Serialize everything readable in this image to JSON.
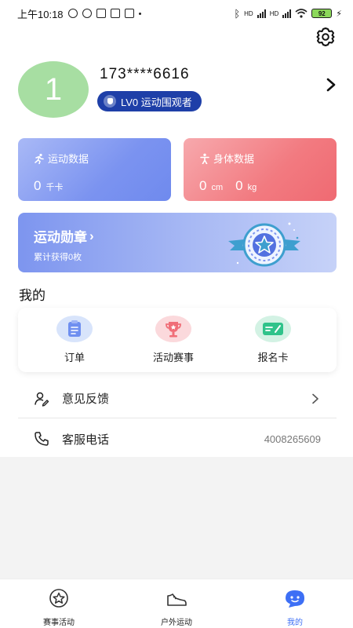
{
  "status_bar": {
    "time": "上午10:18",
    "battery": "92",
    "net_label_1": "HD",
    "net_label_2": "HD"
  },
  "profile": {
    "avatar_text": "1",
    "phone": "173****6616",
    "level_badge": "LV0 运动围观者"
  },
  "stats": {
    "sport": {
      "title": "运动数据",
      "value": "0",
      "unit": "千卡"
    },
    "body": {
      "title": "身体数据",
      "height_value": "0",
      "height_unit": "cm",
      "weight_value": "0",
      "weight_unit": "kg"
    }
  },
  "medal": {
    "title": "运动勋章",
    "arrow": "›",
    "subtitle": "累计获得0枚"
  },
  "section_title": "我的",
  "shortcuts": [
    {
      "label": "订单",
      "icon": "clipboard-icon"
    },
    {
      "label": "活动赛事",
      "icon": "trophy-icon"
    },
    {
      "label": "报名卡",
      "icon": "ticket-icon"
    }
  ],
  "list": {
    "feedback": {
      "label": "意见反馈",
      "icon": "feedback-icon"
    },
    "service": {
      "label": "客服电话",
      "value": "4008265609",
      "icon": "phone-icon"
    }
  },
  "tabbar": {
    "events": "赛事活动",
    "outdoor": "户外运动",
    "mine": "我的"
  },
  "colors": {
    "accent": "#3d6ff5",
    "level_badge": "#1e3fa8",
    "avatar": "#a7dea2",
    "sport_card": "#7b93f0",
    "body_card": "#f27a80"
  }
}
